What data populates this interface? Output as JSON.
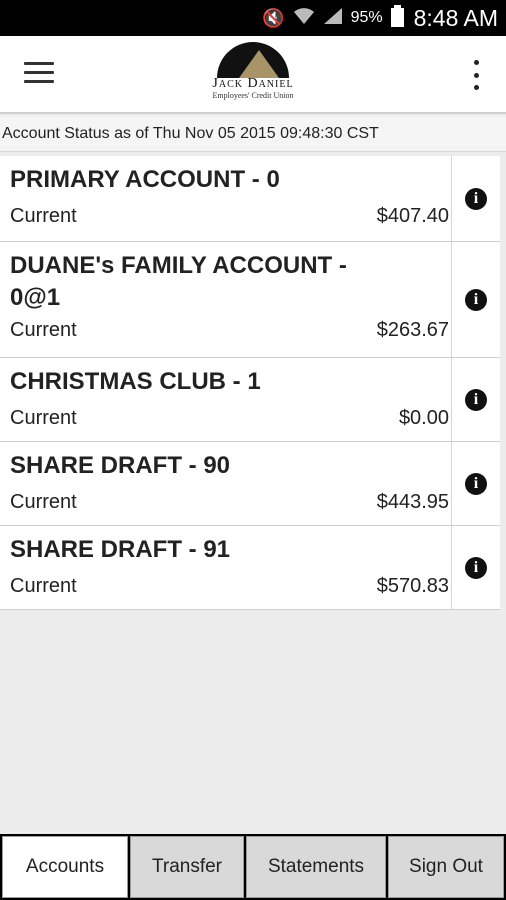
{
  "status_bar": {
    "battery": "95%",
    "time": "8:48 AM",
    "icons": [
      "mute-icon",
      "wifi-icon",
      "signal-icon",
      "battery-icon"
    ]
  },
  "header": {
    "logo_name": "Jack Daniel",
    "logo_sub": "Employees' Credit Union"
  },
  "account_status": "Account Status as of Thu Nov 05 2015 09:48:30 CST",
  "accounts": [
    {
      "title": "PRIMARY ACCOUNT - 0",
      "label": "Current",
      "amount": "$407.40"
    },
    {
      "title": "DUANE's FAMILY ACCOUNT - 0@1",
      "label": "Current",
      "amount": "$263.67"
    },
    {
      "title": "CHRISTMAS CLUB - 1",
      "label": "Current",
      "amount": "$0.00"
    },
    {
      "title": "SHARE DRAFT - 90",
      "label": "Current",
      "amount": "$443.95"
    },
    {
      "title": "SHARE DRAFT - 91",
      "label": "Current",
      "amount": "$570.83"
    }
  ],
  "tabs": [
    {
      "label": "Accounts"
    },
    {
      "label": "Transfer"
    },
    {
      "label": "Statements"
    },
    {
      "label": "Sign Out"
    }
  ],
  "colors": {
    "logo_gold": "#a89467",
    "logo_black": "#111111"
  }
}
